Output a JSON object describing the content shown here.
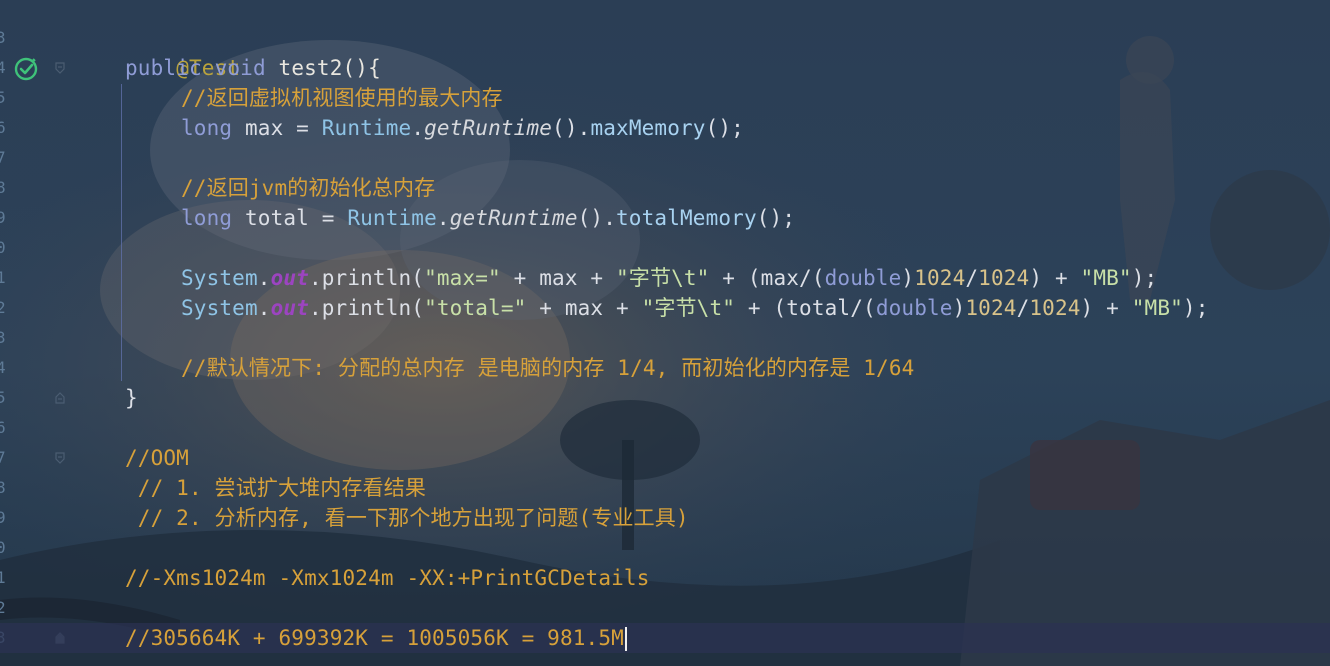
{
  "editor": {
    "line_numbers": [
      "3",
      "4",
      "5",
      "6",
      "7",
      "8",
      "9",
      "0",
      "1",
      "2",
      "3",
      "4",
      "5",
      "6",
      "7",
      "8",
      "9",
      "0",
      "1",
      "2",
      "3"
    ],
    "colors": {
      "annotation": "#b9a33c",
      "keyword": "#8f9cd6",
      "comment": "#d7a13a",
      "string": "#c8e0a8",
      "class": "#8fc4e6",
      "static_field": "#9c44c0",
      "run_icon": "#3fc27a"
    },
    "gutter_icons": [
      "run-test-icon",
      "fold-icon"
    ],
    "lines": {
      "l1": {
        "annotation": "@Test"
      },
      "l2": {
        "kw1": "public",
        "kw2": "void",
        "method_decl": "test2(){"
      },
      "l3": {
        "comment": "//返回虚拟机视图使用的最大内存"
      },
      "l4": {
        "type": "long",
        "text": " max = ",
        "cls": "Runtime",
        "dot": ".",
        "static_call": "getRuntime",
        "paren": "().",
        "method": "maxMemory",
        "end": "();"
      },
      "l6": {
        "comment": "//返回jvm的初始化总内存"
      },
      "l7": {
        "type": "long",
        "text": " total = ",
        "cls": "Runtime",
        "dot": ".",
        "static_call": "getRuntime",
        "paren": "().",
        "method": "totalMemory",
        "end": "();"
      },
      "l9": {
        "cls": "System",
        "dot": ".",
        "field": "out",
        "call": ".println(",
        "s1": "\"max=\"",
        "p1": " + max + ",
        "s2": "\"字节\\t\"",
        "p2": " + (max/(",
        "kw": "double",
        "p3": ")",
        "n1": "1024",
        "p4": "/",
        "n2": "1024",
        "p5": ") + ",
        "s3": "\"MB\"",
        "end": ");"
      },
      "l10": {
        "cls": "System",
        "dot": ".",
        "field": "out",
        "call": ".println(",
        "s1": "\"total=\"",
        "p1": " + max + ",
        "s2": "\"字节\\t\"",
        "p2": " + (total/(",
        "kw": "double",
        "p3": ")",
        "n1": "1024",
        "p4": "/",
        "n2": "1024",
        "p5": ") + ",
        "s3": "\"MB\"",
        "end": ");"
      },
      "l12": {
        "comment": "//默认情况下: 分配的总内存 是电脑的内存 1/4, 而初始化的内存是 1/64"
      },
      "l13": {
        "brace": "}"
      },
      "l15": {
        "comment": "//OOM"
      },
      "l16": {
        "comment": " // 1. 尝试扩大堆内存看结果"
      },
      "l17": {
        "comment": " // 2. 分析内存, 看一下那个地方出现了问题(专业工具)"
      },
      "l19": {
        "comment": "//-Xms1024m -Xmx1024m -XX:+PrintGCDetails"
      },
      "l21": {
        "comment": "//305664K + 699392K = 1005056K = 981.5M"
      }
    }
  }
}
